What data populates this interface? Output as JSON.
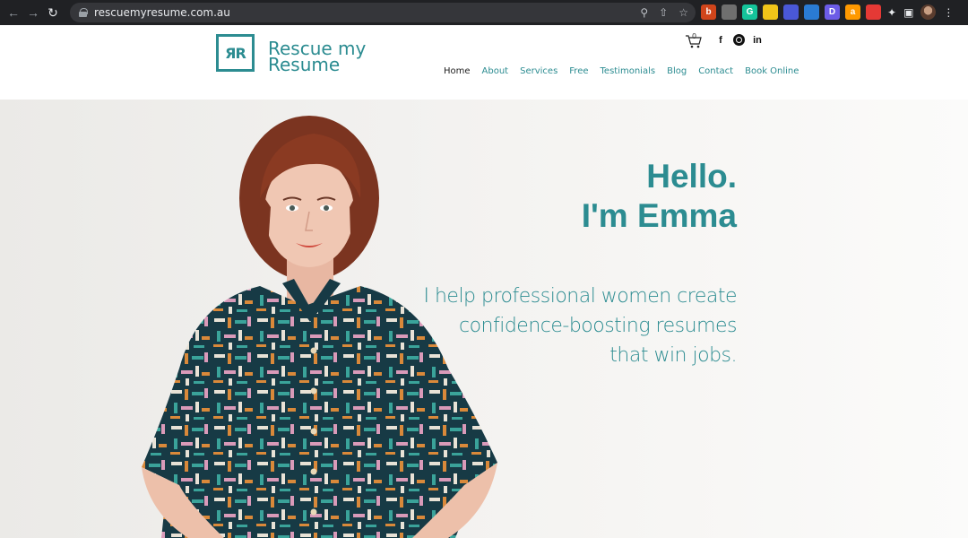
{
  "browser": {
    "url": "rescuemyresume.com.au",
    "nav_icons": [
      "back-arrow-icon",
      "forward-arrow-icon",
      "reload-icon"
    ],
    "extensions": [
      {
        "name": "ext-b",
        "label": "b",
        "color": "#d0451b"
      },
      {
        "name": "ext-grey",
        "label": "",
        "color": "#6f6f6f"
      },
      {
        "name": "ext-grammarly",
        "label": "G",
        "color": "#15c39a"
      },
      {
        "name": "ext-yellow",
        "label": "",
        "color": "#f0c419"
      },
      {
        "name": "ext-blue-gear",
        "label": "",
        "color": "#4a58d6"
      },
      {
        "name": "ext-map",
        "label": "",
        "color": "#2a7bd4"
      },
      {
        "name": "ext-d",
        "label": "D",
        "color": "#6c5ce7"
      },
      {
        "name": "ext-amazon",
        "label": "a",
        "color": "#ff9900"
      },
      {
        "name": "ext-red-circle",
        "label": "",
        "color": "#e53935"
      }
    ]
  },
  "header": {
    "logo_monogram": "ЯR",
    "brand_line1": "Rescue my",
    "brand_line2": "Resume",
    "cart_count": "0",
    "nav": [
      "Home",
      "About",
      "Services",
      "Free",
      "Testimonials",
      "Blog",
      "Contact",
      "Book Online"
    ],
    "socials": [
      "f",
      "",
      "in"
    ]
  },
  "hero": {
    "greeting_line1": "Hello.",
    "greeting_line2": "I'm Emma",
    "tagline_line1": "I help professional women create",
    "tagline_line2": "confidence-boosting resumes",
    "tagline_line3": "that win jobs."
  },
  "colors": {
    "brand_teal": "#2c8c91",
    "chrome_bg": "#202124"
  }
}
